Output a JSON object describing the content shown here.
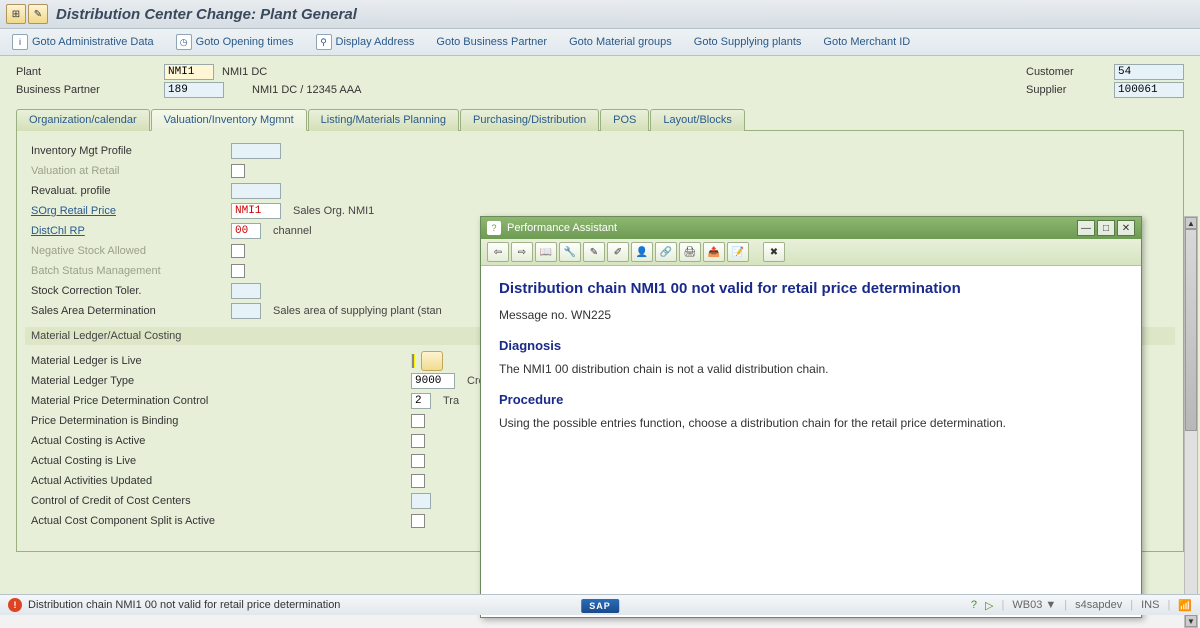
{
  "title": "Distribution Center Change: Plant General",
  "toolbar": [
    {
      "icon": "i",
      "label": "Goto Administrative Data"
    },
    {
      "icon": "⏰",
      "label": "Goto Opening times"
    },
    {
      "icon": "⚲",
      "label": "Display Address"
    },
    {
      "icon": "",
      "label": "Goto Business Partner"
    },
    {
      "icon": "",
      "label": "Goto Material groups"
    },
    {
      "icon": "",
      "label": "Goto Supplying plants"
    },
    {
      "icon": "",
      "label": "Goto Merchant ID"
    }
  ],
  "header": {
    "plant_label": "Plant",
    "plant_value": "NMI1",
    "plant_desc": "NMI1 DC",
    "bp_label": "Business Partner",
    "bp_value": "189",
    "bp_desc": "NMI1 DC / 12345 AAA",
    "customer_label": "Customer",
    "customer_value": "54",
    "supplier_label": "Supplier",
    "supplier_value": "100061"
  },
  "tabs": [
    "Organization/calendar",
    "Valuation/Inventory Mgmnt",
    "Listing/Materials Planning",
    "Purchasing/Distribution",
    "POS",
    "Layout/Blocks"
  ],
  "active_tab": 1,
  "form": {
    "inv_profile": "Inventory Mgt Profile",
    "val_retail": "Valuation at Retail",
    "reval_profile": "Revaluat. profile",
    "sorg": "SOrg Retail Price",
    "sorg_val": "NMI1",
    "sorg_desc": "Sales Org. NMI1",
    "distchl": "DistChl RP",
    "distchl_val": "00",
    "distchl_desc": "channel",
    "neg_stock": "Negative Stock Allowed",
    "batch_status": "Batch Status Management",
    "stock_corr": "Stock Correction Toler.",
    "sales_area": "Sales Area Determination",
    "sales_area_desc": "Sales area of supplying plant (stan"
  },
  "section2": "Material Ledger/Actual Costing",
  "form2": {
    "ml_live": "Material Ledger is Live",
    "ml_type": "Material Ledger Type",
    "ml_type_val": "9000",
    "ml_type_desc": "Crc",
    "mpdc": "Material Price Determination Control",
    "mpdc_val": "2",
    "mpdc_desc": "Tra",
    "pdb": "Price Determination is Binding",
    "aca": "Actual Costing is Active",
    "acl": "Actual Costing is Live",
    "aau": "Actual Activities Updated",
    "cccc": "Control of Credit of Cost Centers",
    "accs": "Actual Cost Component Split is Active"
  },
  "popup": {
    "title": "Performance Assistant",
    "heading": "Distribution chain NMI1 00 not valid for retail price determination",
    "msg_no": "Message no. WN225",
    "diagnosis_h": "Diagnosis",
    "diagnosis": "The NMI1 00 distribution chain is not a valid distribution chain.",
    "procedure_h": "Procedure",
    "procedure": "Using the possible entries function, choose a distribution chain for the retail price determination."
  },
  "status": {
    "msg": "Distribution chain NMI1 00 not valid for retail price determination",
    "system": "WB03",
    "host": "s4sapdev",
    "mode": "INS"
  }
}
